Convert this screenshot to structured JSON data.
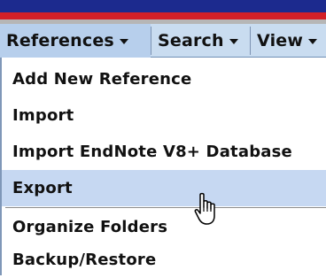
{
  "menubar": {
    "tabs": [
      {
        "label": "References",
        "state": "open"
      },
      {
        "label": "Search",
        "state": "closed"
      },
      {
        "label": "View",
        "state": "closed"
      }
    ]
  },
  "dropdown": {
    "items": [
      {
        "label": "Add New Reference"
      },
      {
        "label": "Import"
      },
      {
        "label": "Import EndNote V8+ Database"
      },
      {
        "label": "Export",
        "state": "hovered"
      },
      {
        "label": "Organize Folders"
      },
      {
        "label": "Backup/Restore"
      }
    ]
  },
  "cursor": {
    "icon": "hand-pointer-cursor-icon"
  },
  "colors": {
    "menubar_bg": "#c9dcf0",
    "highlight": "#c6d8f2",
    "top_stripe_blue": "#1c2a8e",
    "top_stripe_red": "#d42027"
  }
}
